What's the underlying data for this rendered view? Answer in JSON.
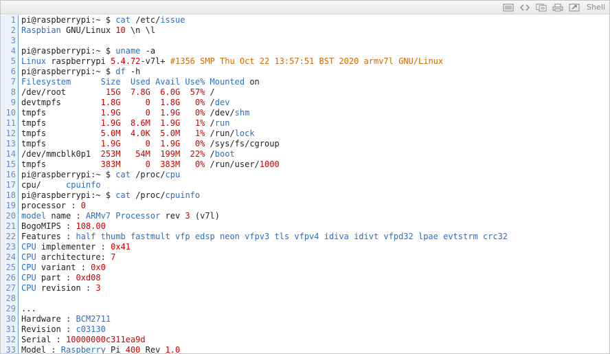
{
  "toolbar": {
    "shell_label": "Shell",
    "icons": [
      "lines-icon",
      "code-icon",
      "copy-icon",
      "print-icon",
      "popup-icon"
    ]
  },
  "line_numbers": [
    "1",
    "2",
    "3",
    "4",
    "5",
    "6",
    "7",
    "8",
    "9",
    "10",
    "11",
    "12",
    "13",
    "14",
    "15",
    "16",
    "17",
    "18",
    "19",
    "20",
    "21",
    "22",
    "23",
    "24",
    "25",
    "26",
    "27",
    "28",
    "29",
    "30",
    "31",
    "32",
    "33"
  ],
  "lines": [
    [
      {
        "t": "pi@raspberrypi:~ $ "
      },
      {
        "t": "cat",
        "c": "b"
      },
      {
        "t": " /etc/"
      },
      {
        "t": "issue",
        "c": "b"
      }
    ],
    [
      {
        "t": "Raspbian",
        "c": "b"
      },
      {
        "t": " GNU/Linux "
      },
      {
        "t": "10",
        "c": "r"
      },
      {
        "t": " \\n \\l"
      }
    ],
    [],
    [
      {
        "t": "pi@raspberrypi:~ $ "
      },
      {
        "t": "uname",
        "c": "b"
      },
      {
        "t": " -a"
      }
    ],
    [
      {
        "t": "Linux",
        "c": "b"
      },
      {
        "t": " raspberrypi "
      },
      {
        "t": "5.4.72",
        "c": "r"
      },
      {
        "t": "-v7l+ "
      },
      {
        "t": "#1356 SMP Thu Oct 22 13:57:51 BST 2020 armv7l GNU/Linux",
        "c": "o"
      }
    ],
    [
      {
        "t": "pi@raspberrypi:~ $ "
      },
      {
        "t": "df",
        "c": "b"
      },
      {
        "t": " -h"
      }
    ],
    [
      {
        "t": "Filesystem      Size  Used Avail Use% Mounted",
        "c": "b"
      },
      {
        "t": " on"
      }
    ],
    [
      {
        "t": "/dev/root        "
      },
      {
        "t": "15G  7.8G  6.0G  57%",
        "c": "r"
      },
      {
        "t": " /"
      }
    ],
    [
      {
        "t": "devtmpfs        "
      },
      {
        "t": "1.8G     0  1.8G   0%",
        "c": "r"
      },
      {
        "t": " /"
      },
      {
        "t": "dev",
        "c": "b"
      }
    ],
    [
      {
        "t": "tmpfs           "
      },
      {
        "t": "1.9G     0  1.9G   0%",
        "c": "r"
      },
      {
        "t": " /dev/"
      },
      {
        "t": "shm",
        "c": "b"
      }
    ],
    [
      {
        "t": "tmpfs           "
      },
      {
        "t": "1.9G  8.6M  1.9G   1%",
        "c": "r"
      },
      {
        "t": " /"
      },
      {
        "t": "run",
        "c": "b"
      }
    ],
    [
      {
        "t": "tmpfs           "
      },
      {
        "t": "5.0M  4.0K  5.0M   1%",
        "c": "r"
      },
      {
        "t": " /run/"
      },
      {
        "t": "lock",
        "c": "b"
      }
    ],
    [
      {
        "t": "tmpfs           "
      },
      {
        "t": "1.9G     0  1.9G   0%",
        "c": "r"
      },
      {
        "t": " /sys/fs/cgroup"
      }
    ],
    [
      {
        "t": "/dev/mmcblk0p1  "
      },
      {
        "t": "253M   54M  199M  22%",
        "c": "r"
      },
      {
        "t": " /"
      },
      {
        "t": "boot",
        "c": "b"
      }
    ],
    [
      {
        "t": "tmpfs           "
      },
      {
        "t": "383M     0  383M   0%",
        "c": "r"
      },
      {
        "t": " /run/user/"
      },
      {
        "t": "1000",
        "c": "r"
      }
    ],
    [
      {
        "t": "pi@raspberrypi:~ $ "
      },
      {
        "t": "cat",
        "c": "b"
      },
      {
        "t": " /proc/"
      },
      {
        "t": "cpu",
        "c": "b"
      }
    ],
    [
      {
        "t": "cpu/     "
      },
      {
        "t": "cpuinfo",
        "c": "b"
      }
    ],
    [
      {
        "t": "pi@raspberrypi:~ $ "
      },
      {
        "t": "cat",
        "c": "b"
      },
      {
        "t": " /proc/"
      },
      {
        "t": "cpuinfo",
        "c": "b"
      }
    ],
    [
      {
        "t": "processor : "
      },
      {
        "t": "0",
        "c": "r"
      }
    ],
    [
      {
        "t": "model",
        "c": "b"
      },
      {
        "t": " name : "
      },
      {
        "t": "ARMv7 Processor",
        "c": "b"
      },
      {
        "t": " rev "
      },
      {
        "t": "3",
        "c": "r"
      },
      {
        "t": " (v7l)"
      }
    ],
    [
      {
        "t": "BogoMIPS : "
      },
      {
        "t": "108.00",
        "c": "r"
      }
    ],
    [
      {
        "t": "Features : "
      },
      {
        "t": "half thumb fastmult vfp edsp neon vfpv3 tls vfpv4 idiva idivt vfpd32 lpae evtstrm crc32",
        "c": "b"
      }
    ],
    [
      {
        "t": "CPU",
        "c": "b"
      },
      {
        "t": " implementer : "
      },
      {
        "t": "0x41",
        "c": "r"
      }
    ],
    [
      {
        "t": "CPU",
        "c": "b"
      },
      {
        "t": " architecture: "
      },
      {
        "t": "7",
        "c": "r"
      }
    ],
    [
      {
        "t": "CPU",
        "c": "b"
      },
      {
        "t": " variant : "
      },
      {
        "t": "0x0",
        "c": "r"
      }
    ],
    [
      {
        "t": "CPU",
        "c": "b"
      },
      {
        "t": " part : "
      },
      {
        "t": "0xd08",
        "c": "r"
      }
    ],
    [
      {
        "t": "CPU",
        "c": "b"
      },
      {
        "t": " revision : "
      },
      {
        "t": "3",
        "c": "r"
      }
    ],
    [],
    [
      {
        "t": "..."
      }
    ],
    [
      {
        "t": "Hardware : "
      },
      {
        "t": "BCM2711",
        "c": "b"
      }
    ],
    [
      {
        "t": "Revision : "
      },
      {
        "t": "c03130",
        "c": "b"
      }
    ],
    [
      {
        "t": "Serial : "
      },
      {
        "t": "10000000c311ea9d",
        "c": "r"
      }
    ],
    [
      {
        "t": "Model : "
      },
      {
        "t": "Raspberry",
        "c": "b"
      },
      {
        "t": " Pi "
      },
      {
        "t": "400",
        "c": "r"
      },
      {
        "t": " Rev "
      },
      {
        "t": "1.0",
        "c": "r"
      }
    ]
  ]
}
